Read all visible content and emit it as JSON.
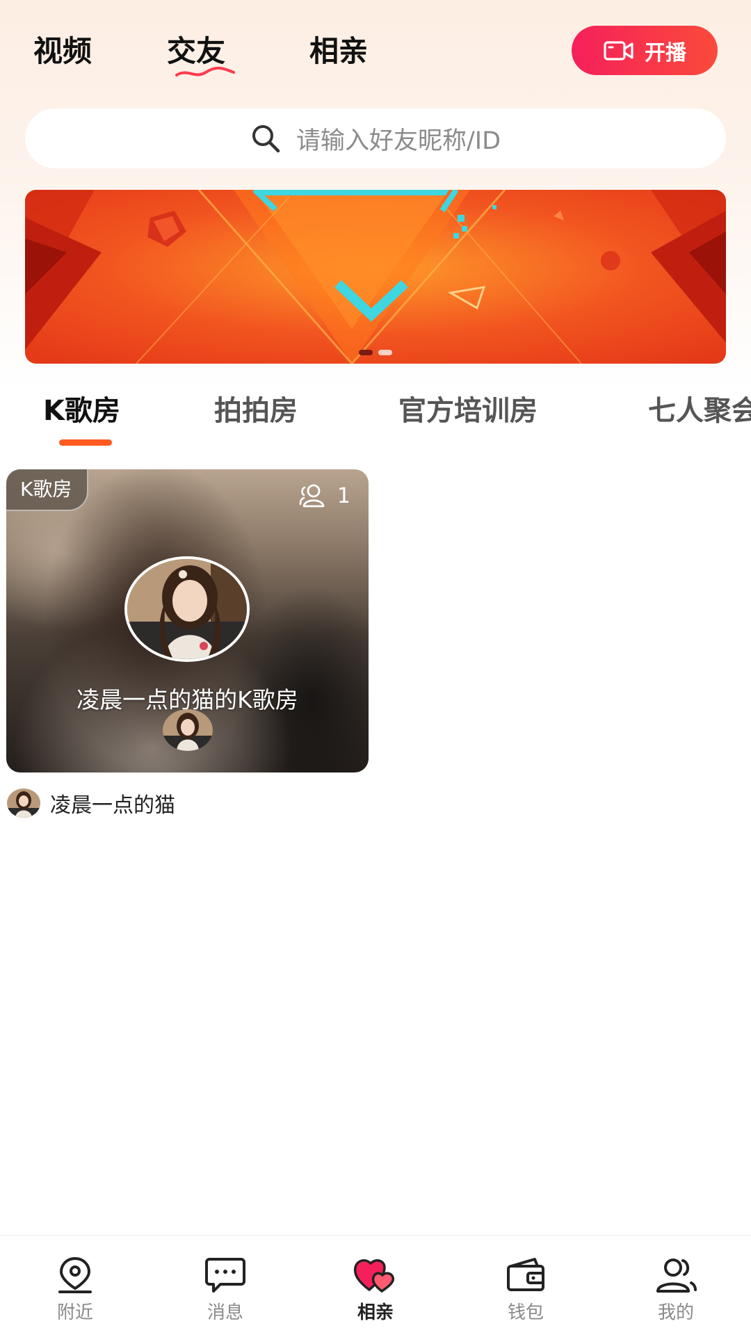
{
  "top_nav": {
    "tabs": [
      {
        "label": "视频"
      },
      {
        "label": "交友"
      },
      {
        "label": "相亲"
      }
    ],
    "active_tab": "交友",
    "live_button_label": "开播"
  },
  "search": {
    "placeholder": "请输入好友昵称/ID"
  },
  "banner": {
    "slide_count": 2,
    "active_slide": 1
  },
  "category_tabs": [
    {
      "label": "K歌房"
    },
    {
      "label": "拍拍房"
    },
    {
      "label": "官方培训房"
    },
    {
      "label": "七人聚会"
    }
  ],
  "active_category": "K歌房",
  "rooms": [
    {
      "badge": "K歌房",
      "online_count": "1",
      "title": "凌晨一点的猫的K歌房",
      "host_name": "凌晨一点的猫"
    }
  ],
  "bottom_nav": [
    {
      "label": "附近",
      "icon": "location-pin-icon"
    },
    {
      "label": "消息",
      "icon": "chat-bubble-icon"
    },
    {
      "label": "相亲",
      "icon": "hearts-icon"
    },
    {
      "label": "钱包",
      "icon": "wallet-icon"
    },
    {
      "label": "我的",
      "icon": "users-icon"
    }
  ],
  "active_bottom_tab": "相亲",
  "colors": {
    "accent": "#ff5a1f",
    "live_button_start": "#f5205b",
    "live_button_end": "#fb4a3a",
    "banner_red": "#f0401e"
  }
}
